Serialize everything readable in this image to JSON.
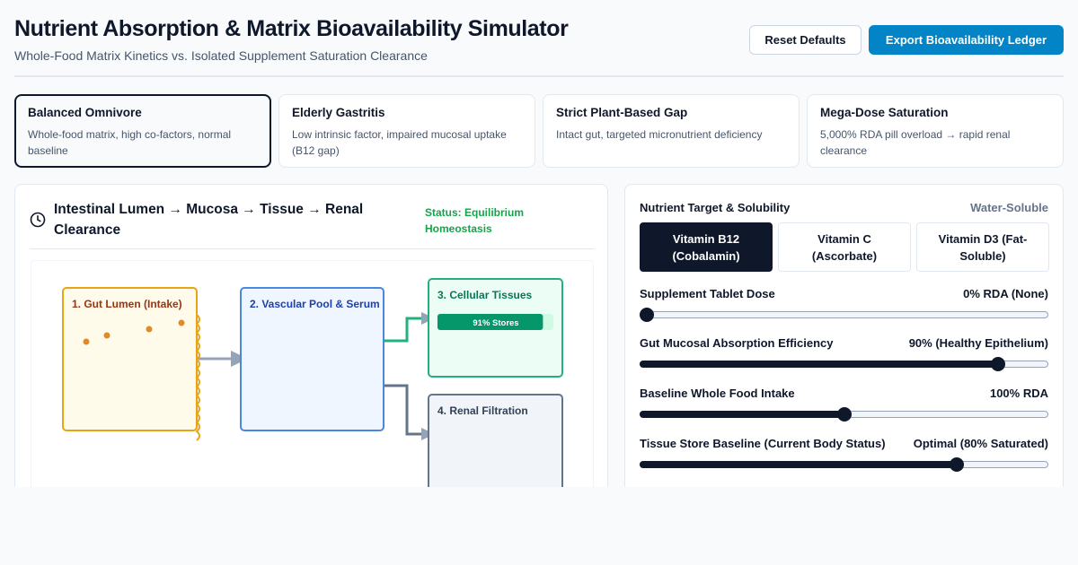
{
  "header": {
    "title": "Nutrient Absorption & Matrix Bioavailability Simulator",
    "subtitle": "Whole-Food Matrix Kinetics vs. Isolated Supplement Saturation Clearance",
    "reset_label": "Reset Defaults",
    "export_label": "Export Bioavailability Ledger",
    "accent_color": "#0284c7"
  },
  "presets": [
    {
      "title": "Balanced Omnivore",
      "desc": "Whole-food matrix, high co-factors, normal baseline",
      "active": true
    },
    {
      "title": "Elderly Gastritis",
      "desc": "Low intrinsic factor, impaired mucosal uptake (B12 gap)",
      "active": false
    },
    {
      "title": "Strict Plant-Based Gap",
      "desc": "Intact gut, targeted micronutrient deficiency",
      "active": false
    },
    {
      "title": "Mega-Dose Saturation",
      "desc": "5,000% RDA pill overload → rapid renal clearance",
      "active": false
    }
  ],
  "pipeline": {
    "icon": "clock-icon",
    "title": "Intestinal Lumen → Mucosa → Tissue → Renal Clearance",
    "status": "Status: Equilibrium Homeostasis",
    "status_color": "#16a34a",
    "nodes": {
      "gut": "1. Gut Lumen (Intake)",
      "vascular": "2. Vascular Pool & Serum",
      "tissues": "3. Cellular Tissues",
      "renal": "4. Renal Filtration"
    },
    "stores_label": "91% Stores",
    "stores_fraction": 0.91
  },
  "controls": {
    "nutrient_label": "Nutrient Target & Solubility",
    "solubility": "Water-Soluble",
    "vitamins": [
      {
        "label": "Vitamin B12 (Cobalamin)",
        "active": true
      },
      {
        "label": "Vitamin C (Ascorbate)",
        "active": false
      },
      {
        "label": "Vitamin D3 (Fat-Soluble)",
        "active": false
      }
    ],
    "sliders": [
      {
        "label": "Supplement Tablet Dose",
        "value": "0% RDA (None)",
        "fraction": 0.0
      },
      {
        "label": "Gut Mucosal Absorption Efficiency",
        "value": "90% (Healthy Epithelium)",
        "fraction": 0.876
      },
      {
        "label": "Baseline Whole Food Intake",
        "value": "100% RDA",
        "fraction": 0.5
      },
      {
        "label": "Tissue Store Baseline (Current Body Status)",
        "value": "Optimal (80% Saturated)",
        "fraction": 0.776
      }
    ]
  }
}
